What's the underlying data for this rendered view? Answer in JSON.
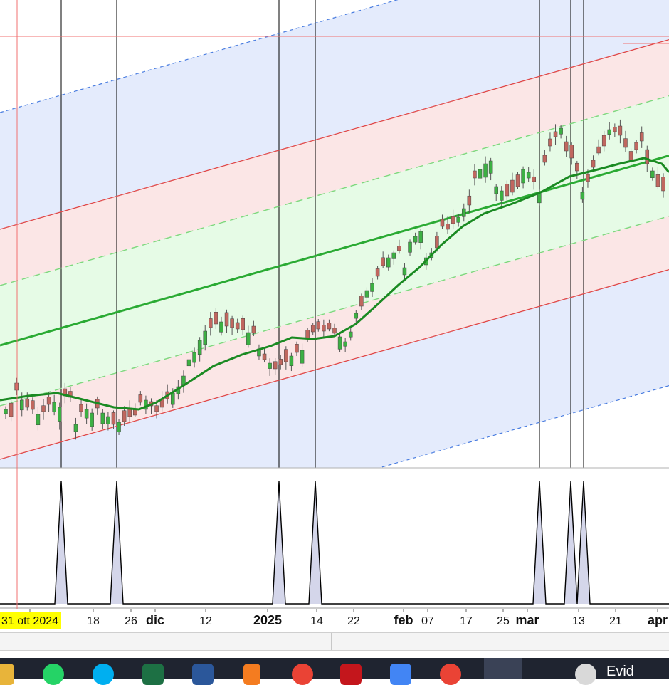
{
  "chart_data": {
    "type": "candlestick",
    "title": "",
    "xlabel": "",
    "ylabel": "",
    "x_tick_labels": [
      "31 ott 2024",
      "18",
      "26",
      "dic",
      "12",
      "2025",
      "14",
      "22",
      "feb",
      "07",
      "17",
      "25",
      "mar",
      "13",
      "21",
      "apr"
    ],
    "major_tick_labels": [
      "dic",
      "2025",
      "feb",
      "mar",
      "apr"
    ],
    "highlighted_tick_label": "31 ott 2024",
    "highlight_color": "#ffff00",
    "candles_close": [
      575,
      585,
      548,
      562,
      572,
      575,
      582,
      578,
      568,
      565,
      572,
      556,
      558,
      596,
      578,
      575,
      580,
      573,
      580,
      585,
      596,
      593,
      592,
      585,
      583,
      565,
      562,
      570,
      578,
      572,
      560,
      552,
      543,
      528,
      505,
      495,
      478,
      465,
      460,
      455,
      452,
      458,
      460,
      462,
      463,
      467,
      468,
      490,
      505,
      510,
      518,
      512,
      508,
      500,
      495,
      492,
      476,
      466,
      462,
      465,
      462,
      468,
      473,
      480,
      466,
      440,
      430,
      408,
      398,
      388,
      373,
      362,
      355,
      352,
      376,
      340,
      332,
      325,
      362,
      355,
      348,
      318,
      322,
      314,
      305,
      293,
      288,
      250,
      238,
      230,
      226,
      262,
      268,
      275,
      270,
      262,
      238,
      242,
      255,
      272,
      228,
      205,
      192,
      180,
      212,
      222,
      240,
      270,
      255,
      235,
      215,
      205,
      182,
      185,
      190,
      207,
      225,
      210,
      198,
      230,
      240,
      262,
      268
    ],
    "candles_bullish": [
      true,
      false,
      false,
      true,
      false,
      false,
      true,
      false,
      false,
      true,
      true,
      false,
      false,
      true,
      false,
      true,
      true,
      false,
      true,
      true,
      false,
      true,
      false,
      false,
      false,
      false,
      true,
      false,
      false,
      false,
      false,
      true,
      true,
      true,
      true,
      true,
      true,
      true,
      false,
      false,
      true,
      false,
      false,
      false,
      false,
      true,
      false,
      true,
      false,
      true,
      false,
      false,
      false,
      true,
      false,
      true,
      false,
      false,
      false,
      false,
      false,
      false,
      true,
      true,
      true,
      true,
      false,
      true,
      true,
      false,
      false,
      true,
      true,
      false,
      true,
      true,
      true,
      true,
      true,
      true,
      false,
      false,
      false,
      false,
      true,
      true,
      false,
      false,
      true,
      true,
      true,
      true,
      true,
      false,
      false,
      false,
      true,
      true,
      false,
      true,
      false,
      false,
      false,
      true,
      false,
      false,
      false,
      true,
      false,
      false,
      false,
      false,
      true,
      false,
      false,
      false,
      false,
      false,
      false,
      false,
      true,
      false,
      false
    ],
    "grid": false,
    "legend": "none",
    "colors": {
      "bullish_candle": "#3cb043",
      "bearish_candle": "#c0675f",
      "moving_average": "#1a8a22",
      "regression_center": "#2aaa33",
      "inner_channel": "#7ed87e",
      "outer_channel": "#e04848",
      "far_channel": "#4a7de0",
      "band_blue": "#e4ebfc",
      "band_pink": "#fbe6e6",
      "band_green": "#e6fbe6",
      "event_line": "#000000",
      "crosshair": "#f07070",
      "event_fill": "#d4d6ea"
    }
  }
}
